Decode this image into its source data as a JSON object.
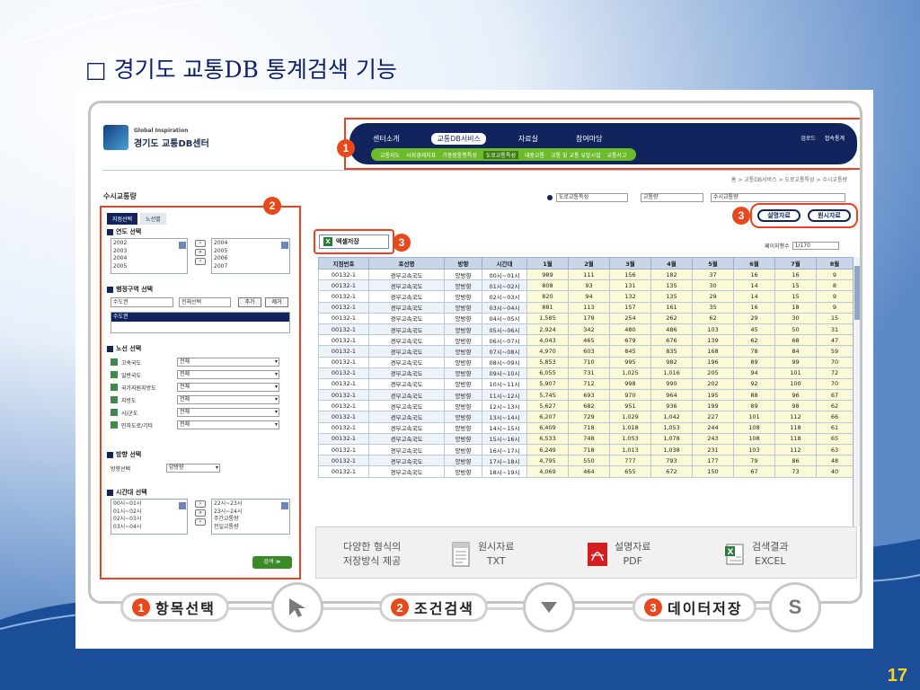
{
  "slide": {
    "title": "□ 경기도 교통DB 통계검색 기능",
    "page_number": "17"
  },
  "app": {
    "logo_sub": "Global Inspiration",
    "logo_main": "경기도 교통DB센터"
  },
  "nav": {
    "top": [
      "센터소개",
      "교통DB서비스",
      "자료실",
      "참여마당"
    ],
    "active": 1,
    "util": [
      "업로드",
      "접속통계"
    ],
    "sub": [
      "교통지도",
      "사회경제지표",
      "기종점통행특성",
      "도로교통특성",
      "대중교통",
      "교통 및 교통 유발시설",
      "교통사고"
    ],
    "sub_active": 3
  },
  "breadcrumb": "홈 > 교통DB서비스 > 도로교통특성 > 수시교통량",
  "page_heading": "수시교통량",
  "filters": {
    "tabs": [
      "지점선택",
      "노선별"
    ],
    "year": {
      "title": "연도 선택",
      "left": [
        "2002",
        "2003",
        "2004",
        "2005"
      ],
      "right": [
        "2004",
        "2005",
        "2006",
        "2007"
      ]
    },
    "region": {
      "title": "행정구역 선택",
      "sido": "수도권",
      "sigungu": "전체선택",
      "add": "추가",
      "remove": "제거",
      "selected": "수도권"
    },
    "road": {
      "title": "노선 선택",
      "items": [
        {
          "name": "고속국도",
          "value": "전체"
        },
        {
          "name": "일반국도",
          "value": "전체"
        },
        {
          "name": "국가지원지방도",
          "value": "전체"
        },
        {
          "name": "지방도",
          "value": "전체"
        },
        {
          "name": "시/군도",
          "value": "전체"
        },
        {
          "name": "민자도로/기타",
          "value": "전체"
        }
      ]
    },
    "direction": {
      "title": "방향 선택",
      "label": "방향선택",
      "value": "양방향"
    },
    "time": {
      "title": "시간대 선택",
      "left": [
        "00시~01시",
        "01시~02시",
        "02시~03시",
        "03시~04시"
      ],
      "right": [
        "22시~23시",
        "23시~24시",
        "주간교통량",
        "전일교통량"
      ]
    },
    "search": "검색 ≫"
  },
  "region_filter": {
    "sido": "도로교통특성",
    "sub": "교통량",
    "type": "수시교통량"
  },
  "actions": {
    "explain": "설명자료",
    "raw": "원시자료",
    "excel": "엑셀저장",
    "page_size_label": "페이지행수",
    "page_size": "1/170"
  },
  "table": {
    "headers": [
      "지점번호",
      "호선명",
      "방향",
      "시간대",
      "1월",
      "2월",
      "3월",
      "4월",
      "5월",
      "6월",
      "7월",
      "8월"
    ],
    "rows": [
      [
        "00132-1",
        "경부고속국도",
        "양방향",
        "00시~01시",
        "989",
        "111",
        "156",
        "182",
        "37",
        "16",
        "16",
        "9"
      ],
      [
        "00132-1",
        "경부고속국도",
        "양방향",
        "01시~02시",
        "808",
        "93",
        "131",
        "135",
        "30",
        "14",
        "15",
        "8"
      ],
      [
        "00132-1",
        "경부고속국도",
        "양방향",
        "02시~03시",
        "820",
        "94",
        "132",
        "135",
        "29",
        "14",
        "15",
        "9"
      ],
      [
        "00132-1",
        "경부고속국도",
        "양방향",
        "03시~04시",
        "881",
        "113",
        "157",
        "161",
        "35",
        "16",
        "18",
        "9"
      ],
      [
        "00132-1",
        "경부고속국도",
        "양방향",
        "04시~05시",
        "1,585",
        "179",
        "254",
        "262",
        "62",
        "29",
        "30",
        "15"
      ],
      [
        "00132-1",
        "경부고속국도",
        "양방향",
        "05시~06시",
        "2,924",
        "342",
        "480",
        "486",
        "103",
        "45",
        "50",
        "31"
      ],
      [
        "00132-1",
        "경부고속국도",
        "양방향",
        "06시~07시",
        "4,043",
        "465",
        "679",
        "676",
        "139",
        "62",
        "68",
        "47"
      ],
      [
        "00132-1",
        "경부고속국도",
        "양방향",
        "07시~08시",
        "4,970",
        "603",
        "845",
        "835",
        "168",
        "78",
        "84",
        "59"
      ],
      [
        "00132-1",
        "경부고속국도",
        "양방향",
        "08시~09시",
        "5,853",
        "710",
        "995",
        "982",
        "196",
        "89",
        "99",
        "70"
      ],
      [
        "00132-1",
        "경부고속국도",
        "양방향",
        "09시~10시",
        "6,055",
        "731",
        "1,025",
        "1,016",
        "205",
        "94",
        "101",
        "72"
      ],
      [
        "00132-1",
        "경부고속국도",
        "양방향",
        "10시~11시",
        "5,907",
        "712",
        "998",
        "990",
        "202",
        "92",
        "100",
        "70"
      ],
      [
        "00132-1",
        "경부고속국도",
        "양방향",
        "11시~12시",
        "5,745",
        "693",
        "970",
        "964",
        "195",
        "88",
        "96",
        "67"
      ],
      [
        "00132-1",
        "경부고속국도",
        "양방향",
        "12시~13시",
        "5,627",
        "682",
        "951",
        "936",
        "199",
        "89",
        "98",
        "62"
      ],
      [
        "00132-1",
        "경부고속국도",
        "양방향",
        "13시~14시",
        "6,207",
        "729",
        "1,029",
        "1,042",
        "227",
        "101",
        "112",
        "66"
      ],
      [
        "00132-1",
        "경부고속국도",
        "양방향",
        "14시~15시",
        "6,409",
        "718",
        "1,018",
        "1,053",
        "244",
        "108",
        "118",
        "61"
      ],
      [
        "00132-1",
        "경부고속국도",
        "양방향",
        "15시~16시",
        "6,533",
        "748",
        "1,053",
        "1,078",
        "243",
        "108",
        "118",
        "65"
      ],
      [
        "00132-1",
        "경부고속국도",
        "양방향",
        "16시~17시",
        "6,249",
        "718",
        "1,013",
        "1,038",
        "231",
        "103",
        "112",
        "63"
      ],
      [
        "00132-1",
        "경부고속국도",
        "양방향",
        "17시~18시",
        "4,795",
        "550",
        "777",
        "793",
        "177",
        "79",
        "86",
        "48"
      ],
      [
        "00132-1",
        "경부고속국도",
        "양방향",
        "18시~19시",
        "4,069",
        "464",
        "655",
        "672",
        "150",
        "67",
        "73",
        "40"
      ]
    ]
  },
  "save_options": {
    "intro": [
      "다양한 형식의",
      "저장방식 제공"
    ],
    "txt": [
      "원시자료",
      "TXT"
    ],
    "pdf": [
      "설명자료",
      "PDF"
    ],
    "excel": [
      "검색결과",
      "EXCEL"
    ]
  },
  "steps": [
    {
      "no": "1",
      "label": "항목선택",
      "icon": "cursor-icon"
    },
    {
      "no": "2",
      "label": "조건검색",
      "icon": "chevron-down-icon"
    },
    {
      "no": "3",
      "label": "데이터저장",
      "icon": "S"
    }
  ],
  "badges": [
    "1",
    "2",
    "3"
  ],
  "colors": {
    "slide_bg": "#1a4e98",
    "title": "#0e1f6e",
    "page_no": "#ffd21e",
    "badge": "#e8491c",
    "nav": "#12245e",
    "subnav": "#6bbb2a"
  }
}
